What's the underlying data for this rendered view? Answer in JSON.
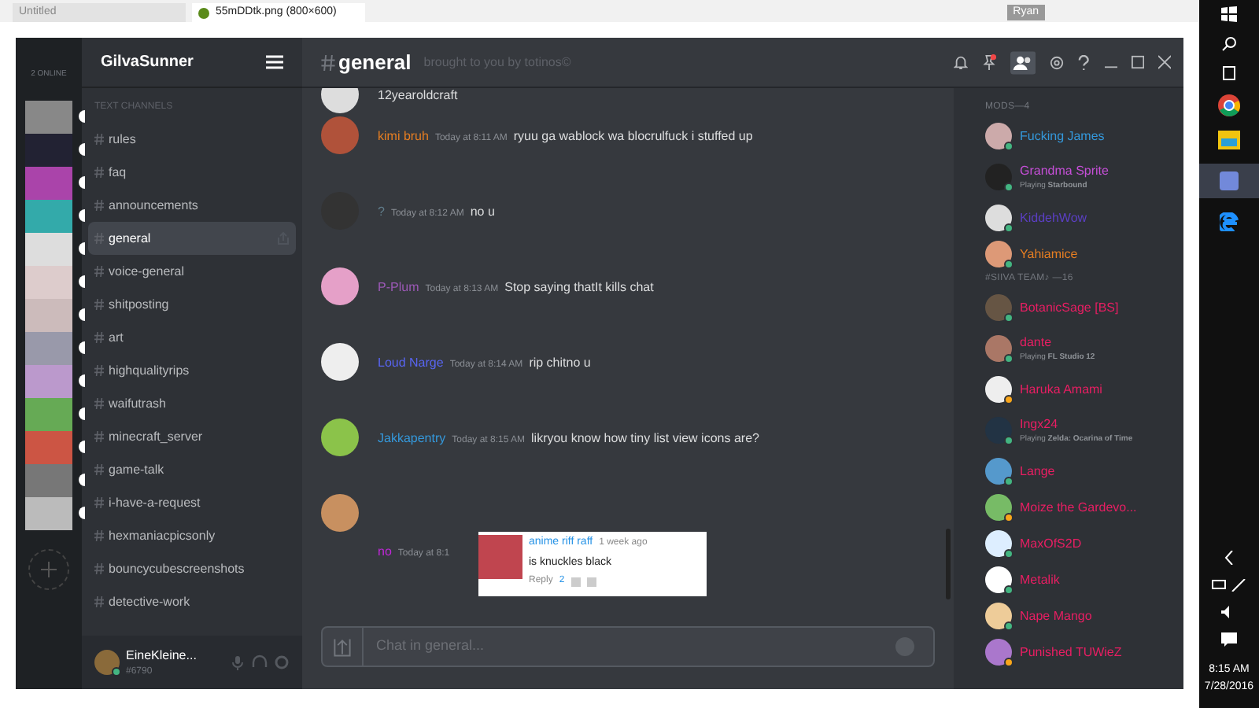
{
  "browser": {
    "tabs": [
      {
        "title": "Untitled",
        "selected": false
      },
      {
        "title": "55mDDtk.png (800×600)",
        "selected": true
      }
    ],
    "user_badge": "Ryan"
  },
  "servers": {
    "online": "2 ONLINE",
    "icons": [
      {
        "unread": true
      },
      {
        "unread": true
      },
      {
        "unread": true
      },
      {
        "unread": true
      },
      {
        "unread": true
      },
      {
        "unread": true
      },
      {
        "unread": true
      },
      {
        "unread": true
      },
      {
        "unread": true
      },
      {
        "unread": true
      },
      {
        "unread": true
      },
      {
        "unread": true
      },
      {
        "unread": true
      }
    ]
  },
  "sidebar": {
    "server_name": "GilvaSunner",
    "heading": "TEXT CHANNELS",
    "channels": [
      {
        "name": "rules",
        "selected": false
      },
      {
        "name": "faq",
        "selected": false
      },
      {
        "name": "announcements",
        "selected": false
      },
      {
        "name": "general",
        "selected": true
      },
      {
        "name": "voice-general",
        "selected": false
      },
      {
        "name": "shitposting",
        "selected": false
      },
      {
        "name": "art",
        "selected": false
      },
      {
        "name": "highqualityrips",
        "selected": false
      },
      {
        "name": "waifutrash",
        "selected": false
      },
      {
        "name": "minecraft_server",
        "selected": false
      },
      {
        "name": "game-talk",
        "selected": false
      },
      {
        "name": "i-have-a-request",
        "selected": false
      },
      {
        "name": "hexmaniacpicsonly",
        "selected": false
      },
      {
        "name": "bouncycubescreenshots",
        "selected": false
      },
      {
        "name": "detective-work",
        "selected": false
      }
    ],
    "user": {
      "name": "EineKleine...",
      "tag": "#6790"
    }
  },
  "chat": {
    "channel": "general",
    "topic": "brought to you by totinos©",
    "messages": [
      {
        "text": "12yearoldcraft"
      },
      {
        "author": "kimi bruh",
        "color": "#e67e22",
        "time": "Today at 8:11 AM",
        "text": "ryuu ga wablock wa blocrulfuck i stuffed up"
      },
      {
        "author": "?",
        "color": "#607d8b",
        "time": "Today at 8:12 AM",
        "text": "no u"
      },
      {
        "author": "P-Plum",
        "color": "#9b59b6",
        "time": "Today at 8:13 AM",
        "text": "Stop saying thatIt kills chat"
      },
      {
        "author": "Loud Narge",
        "color": "#5865f2",
        "time": "Today at 8:14 AM",
        "text": "rip chitno u"
      },
      {
        "author": "Jakkapentry",
        "color": "#3498db",
        "time": "Today at 8:15 AM",
        "text": "likryou know how tiny list view icons are?"
      },
      {
        "author": "no",
        "color": "#c027d8",
        "time": "Today at 8:1"
      }
    ],
    "popup": {
      "author": "anime riff raff",
      "time": "1 week ago",
      "text": "is knuckles black",
      "reply": "Reply",
      "count": "2"
    },
    "input": {
      "placeholder": "Chat in general..."
    }
  },
  "members": {
    "groups": [
      {
        "title": "MODS—4",
        "members": [
          {
            "name": "Fucking James",
            "color": "#3498db",
            "idle": false
          },
          {
            "name": "Grandma Sprite",
            "color": "#c64fd8",
            "idle": false,
            "game": "Playing **Starbound**"
          },
          {
            "name": "KiddehWow",
            "color": "#5b3fc4",
            "idle": false
          },
          {
            "name": "Yahiamice",
            "color": "#e67e22",
            "idle": false
          }
        ]
      },
      {
        "title": "#SIIVA TEAM♪ —16",
        "members": [
          {
            "name": "BotanicSage [BS]",
            "color": "#e91e63",
            "idle": false
          },
          {
            "name": "dante",
            "color": "#e91e63",
            "idle": false,
            "game": "Playing **FL Studio 12**"
          },
          {
            "name": "Haruka Amami",
            "color": "#e91e63",
            "idle": true
          },
          {
            "name": "Ingx24",
            "color": "#e91e63",
            "idle": false,
            "game": "Playing **Zelda: Ocarina of Time**"
          },
          {
            "name": "Lange",
            "color": "#e91e63",
            "idle": false
          },
          {
            "name": "Moize the Gardevo...",
            "color": "#e91e63",
            "idle": true
          },
          {
            "name": "MaxOfS2D",
            "color": "#e91e63",
            "idle": false
          },
          {
            "name": "Metalik",
            "color": "#e91e63",
            "idle": false
          },
          {
            "name": "Nape Mango",
            "color": "#e91e63",
            "idle": false
          },
          {
            "name": "Punished TUWieZ",
            "color": "#e91e63",
            "idle": true
          }
        ]
      }
    ]
  },
  "taskbar": {
    "time": "8:15 AM",
    "date": "7/28/2016"
  }
}
